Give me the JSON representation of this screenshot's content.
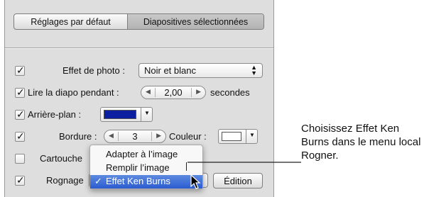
{
  "tabs": {
    "left": "Réglages par défaut",
    "right": "Diapositives sélectionnées"
  },
  "rows": {
    "effet": {
      "label": "Effet de photo :",
      "value": "Noir et blanc",
      "checked": true
    },
    "lire": {
      "label": "Lire la diapo pendant :",
      "value": "2,00",
      "suffix": "secondes",
      "checked": true
    },
    "arriere": {
      "label": "Arrière-plan :",
      "checked": true,
      "color": "#0b1fa0"
    },
    "bordure": {
      "label": "Bordure :",
      "value": "3",
      "couleur_label": "Couleur :",
      "checked": true,
      "color": "#ffffff"
    },
    "cartouche": {
      "label": "Cartouche",
      "checked": false
    },
    "rognage": {
      "label": "Rognage",
      "checked": true,
      "button": "Édition"
    }
  },
  "menu": {
    "items": [
      "Adapter à l’image",
      "Remplir l’image",
      "Effet Ken Burns"
    ],
    "selected_index": 2,
    "check": "✓"
  },
  "callout": "Choisissez Effet Ken Burns dans le menu local Rogner.",
  "colors": {
    "panel": "#dedede",
    "highlight": "#2b5cd0",
    "background_swatch": "#0b1fa0"
  }
}
